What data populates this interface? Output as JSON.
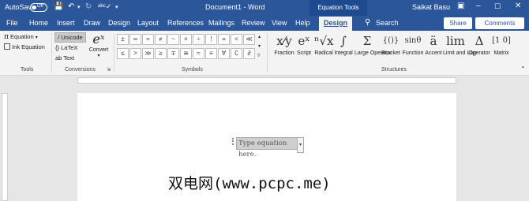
{
  "titlebar": {
    "autosave_label": "AutoSave",
    "autosave_state": "Off",
    "document_title": "Document1 - Word",
    "contextual_tab": "Equation Tools",
    "user_name": "Saikat Basu"
  },
  "tabs": [
    "File",
    "Home",
    "Insert",
    "Draw",
    "Design",
    "Layout",
    "References",
    "Mailings",
    "Review",
    "View",
    "Help",
    "Design"
  ],
  "active_tab": "Design",
  "search_label": "Search",
  "share_label": "Share",
  "comments_label": "Comments",
  "groups": {
    "tools": {
      "label": "Tools",
      "equation": "Equation",
      "ink_equation": "Ink Equation"
    },
    "conversions": {
      "label": "Conversions",
      "unicode": "Unicode",
      "latex": "LaTeX",
      "text": "Text",
      "convert": "Convert"
    },
    "symbols": {
      "label": "Symbols",
      "row1": [
        "±",
        "∞",
        "=",
        "≠",
        "~",
        "×",
        "÷",
        "!",
        "∝",
        "<",
        "≪"
      ],
      "row2": [
        "≤",
        ">",
        "≫",
        "≥",
        "∓",
        "≅",
        "≈",
        "≡",
        "∀",
        "∁",
        "∂"
      ]
    },
    "structures": {
      "label": "Structures",
      "items": [
        {
          "glyph": "x⁄y",
          "label": "Fraction"
        },
        {
          "glyph": "eˣ",
          "label": "Script"
        },
        {
          "glyph": "ⁿ√x",
          "label": "Radical"
        },
        {
          "glyph": "∫",
          "label": "Integral"
        },
        {
          "glyph": "Σ",
          "label": "Large Operator"
        },
        {
          "glyph": "{()}",
          "label": "Bracket"
        },
        {
          "glyph": "sinθ",
          "label": "Function"
        },
        {
          "glyph": "ä",
          "label": "Accent"
        },
        {
          "glyph": "lim",
          "label": "Limit and Log"
        },
        {
          "glyph": "Δ",
          "label": "Operator"
        },
        {
          "glyph": "[1 0]",
          "label": "Matrix"
        }
      ]
    }
  },
  "document": {
    "equation_placeholder": "Type equation here.",
    "watermark": "双电网(www.pcpc.me)"
  }
}
